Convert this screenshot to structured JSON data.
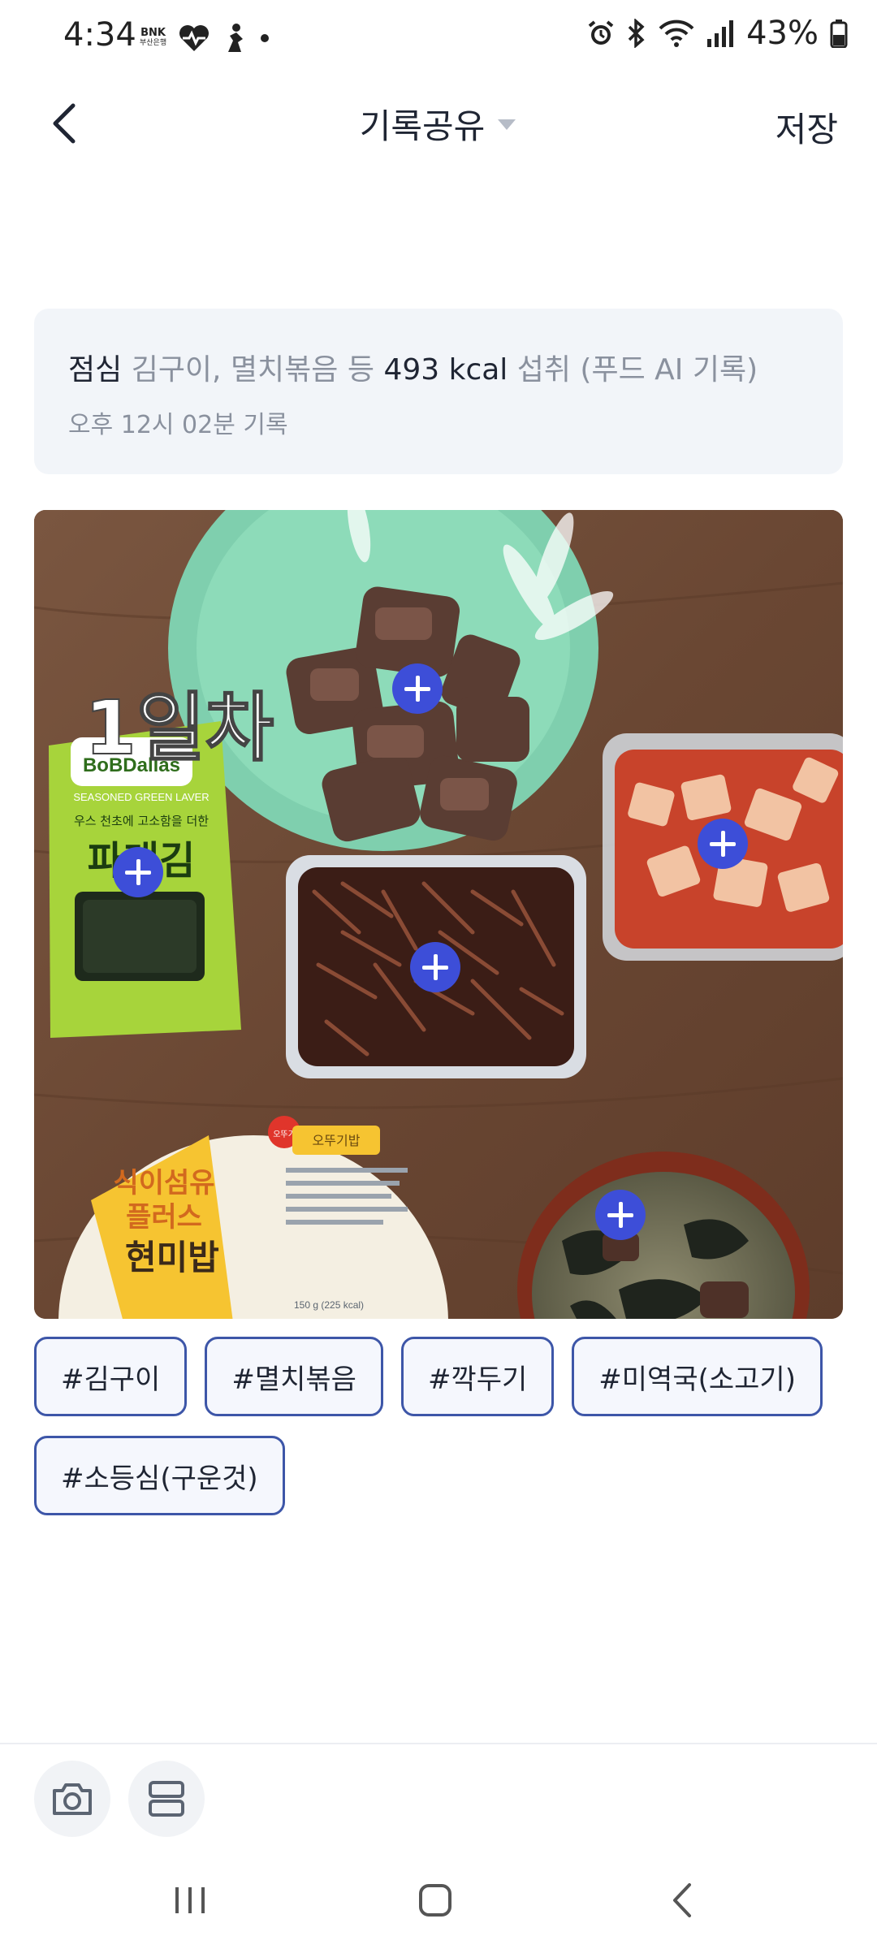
{
  "status_bar": {
    "time": "4:34",
    "bank_badge_line1": "BNK",
    "bank_badge_line2": "부산은행",
    "battery": "43%"
  },
  "header": {
    "title": "기록공유",
    "save_label": "저장"
  },
  "summary": {
    "meal": "점심",
    "foods": " 김구이, 멸치볶음 등 ",
    "kcal": "493 kcal",
    "suffix": " 섭취 (푸드 AI 기록)",
    "time": "오후 12시 02분 기록"
  },
  "photo": {
    "overlay_text": "1일차",
    "seaweed_pack": {
      "brand": "BoBDallas",
      "english": "SEASONED GREEN LAVER",
      "slogan": "우스 천초에 고소함을 더한",
      "name": "파래김"
    },
    "rice_pack": {
      "brand": "오뚜기",
      "tag": "오뚜기밥",
      "line1": "식이섬유",
      "line2": "플러스",
      "line3": "현미밥",
      "weight": "150 g (225 kcal)"
    }
  },
  "tags": [
    {
      "label": "#김구이"
    },
    {
      "label": "#멸치볶음"
    },
    {
      "label": "#깍두기"
    },
    {
      "label": "#미역국(소고기)"
    },
    {
      "label": "#소등심(구운것)"
    }
  ],
  "toolbar": {
    "camera_icon": "camera-icon",
    "layout_icon": "layout-icon"
  },
  "colors": {
    "accent": "#3d4ed8",
    "tag_border": "#3d56a8",
    "card_bg": "#f2f5f9"
  }
}
